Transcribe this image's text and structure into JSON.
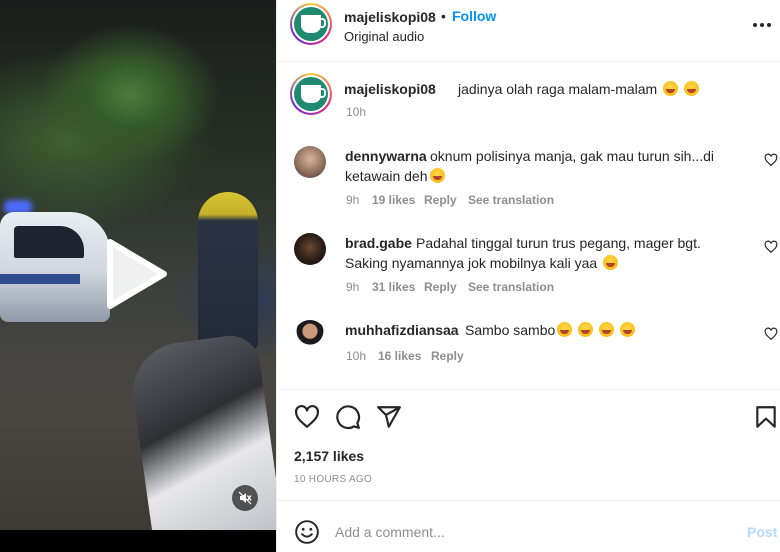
{
  "post": {
    "username": "majeliskopi08",
    "follow_label": "Follow",
    "separator": "•",
    "audio": "Original audio",
    "caption": "jadinya olah raga malam-malam",
    "caption_time": "10h",
    "likes": "2,157 likes",
    "posted_ago": "10 HOURS AGO"
  },
  "comments": [
    {
      "username": "dennywarna",
      "text_line1": "oknum polisinya manja, gak mau turun sih...di",
      "text_line2": "ketawain deh",
      "time": "9h",
      "likes": "19 likes",
      "reply": "Reply",
      "translate": "See translation"
    },
    {
      "username": "brad.gabe",
      "text_line1": "Padahal tinggal turun trus pegang, mager bgt.",
      "text_line2": "Saking nyamannya jok mobilnya kali yaa",
      "time": "9h",
      "likes": "31 likes",
      "reply": "Reply",
      "translate": "See translation"
    },
    {
      "username": "muhhafizdiansaa",
      "text_line1": "Sambo sambo",
      "time": "10h",
      "likes": "16 likes",
      "reply": "Reply"
    }
  ],
  "composer": {
    "placeholder": "Add a comment...",
    "post_label": "Post"
  },
  "colors": {
    "accent": "#0095f6",
    "post_disabled": "#b3dbff",
    "muted": "#8e8e8e"
  },
  "icons": [
    "play-icon",
    "mute-icon",
    "more-icon",
    "heart-icon",
    "comment-icon",
    "share-icon",
    "bookmark-icon",
    "emoji-icon"
  ]
}
